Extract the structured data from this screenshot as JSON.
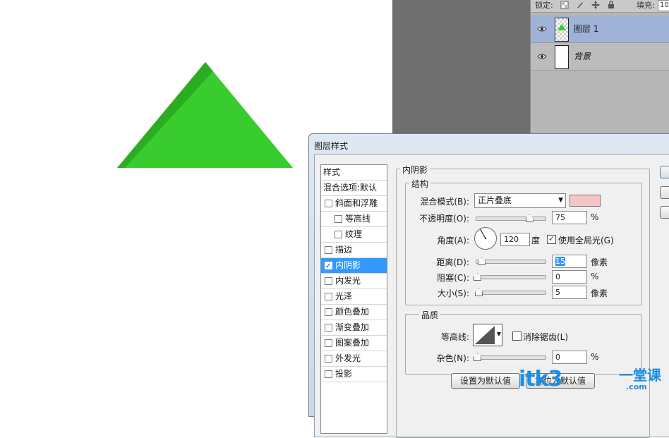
{
  "layers_panel": {
    "lock_label": "锁定:",
    "fill_label": "填充:",
    "fill_value": "10",
    "layers": [
      {
        "name": "图层 1",
        "visible": true,
        "selected": true
      },
      {
        "name": "背景",
        "visible": true,
        "selected": false
      }
    ]
  },
  "canvas": {
    "shape_color": "#39cc2e",
    "shadow_color": "#2aa61f"
  },
  "dialog": {
    "title": "图层样式",
    "styles_header": "样式",
    "blending_options": "混合选项:默认",
    "items": [
      {
        "label": "斜面和浮雕",
        "checked": false,
        "sub": false,
        "active": false
      },
      {
        "label": "等高线",
        "checked": false,
        "sub": true,
        "active": false
      },
      {
        "label": "纹理",
        "checked": false,
        "sub": true,
        "active": false
      },
      {
        "label": "描边",
        "checked": false,
        "sub": false,
        "active": false
      },
      {
        "label": "内阴影",
        "checked": true,
        "sub": false,
        "active": true
      },
      {
        "label": "内发光",
        "checked": false,
        "sub": false,
        "active": false
      },
      {
        "label": "光泽",
        "checked": false,
        "sub": false,
        "active": false
      },
      {
        "label": "颜色叠加",
        "checked": false,
        "sub": false,
        "active": false
      },
      {
        "label": "渐变叠加",
        "checked": false,
        "sub": false,
        "active": false
      },
      {
        "label": "图案叠加",
        "checked": false,
        "sub": false,
        "active": false
      },
      {
        "label": "外发光",
        "checked": false,
        "sub": false,
        "active": false
      },
      {
        "label": "投影",
        "checked": false,
        "sub": false,
        "active": false
      }
    ],
    "section_title": "内阴影",
    "structure": {
      "title": "结构",
      "blend_mode_label": "混合模式(B):",
      "blend_mode_value": "正片叠底",
      "blend_color": "#f6c4c4",
      "opacity_label": "不透明度(O):",
      "opacity_value": "75",
      "opacity_unit": "%",
      "opacity_fraction": 0.75,
      "angle_label": "角度(A):",
      "angle_value": "120",
      "angle_unit": "度",
      "global_light_label": "使用全局光(G)",
      "global_light_checked": true,
      "distance_label": "距离(D):",
      "distance_value": "15",
      "distance_unit": "像素",
      "distance_fraction": 0.06,
      "choke_label": "阻塞(C):",
      "choke_value": "0",
      "choke_unit": "%",
      "size_label": "大小(S):",
      "size_value": "5",
      "size_unit": "像素",
      "size_fraction": 0.02
    },
    "quality": {
      "title": "品质",
      "contour_label": "等高线:",
      "antialias_label": "消除锯齿(L)",
      "antialias_checked": false,
      "noise_label": "杂色(N):",
      "noise_value": "0",
      "noise_unit": "%"
    },
    "buttons": {
      "make_default": "设置为默认值",
      "reset_default": "复位为默认值"
    }
  },
  "watermark": {
    "brand": "itk3",
    "suffix": ".com",
    "tagline": "一堂课"
  }
}
